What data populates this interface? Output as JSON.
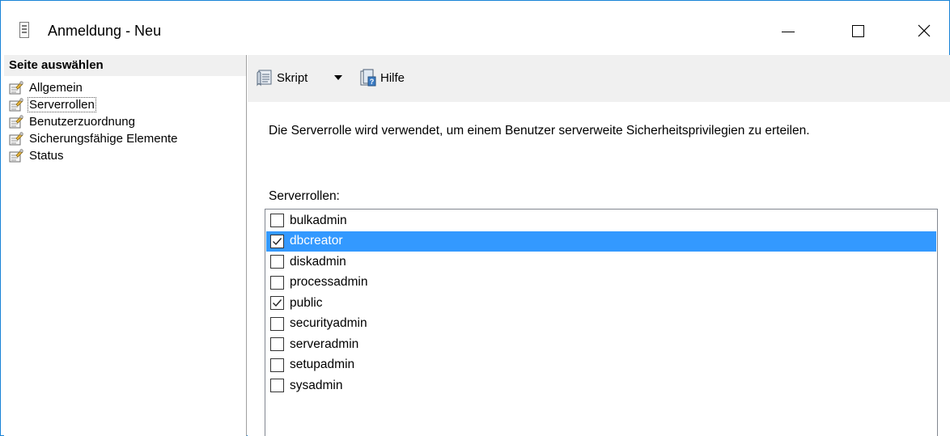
{
  "window": {
    "title": "Anmeldung - Neu"
  },
  "left_panel": {
    "header": "Seite auswählen",
    "items": [
      {
        "label": "Allgemein",
        "icon": "wrench-page-icon"
      },
      {
        "label": "Serverrollen",
        "icon": "wrench-page-icon",
        "selected": true
      },
      {
        "label": "Benutzerzuordnung",
        "icon": "wrench-page-icon"
      },
      {
        "label": "Sicherungsfähige Elemente",
        "icon": "wrench-page-icon"
      },
      {
        "label": "Status",
        "icon": "wrench-page-icon"
      }
    ]
  },
  "toolbar": {
    "script_label": "Skript",
    "help_label": "Hilfe"
  },
  "content": {
    "description": "Die Serverrolle wird verwendet, um einem Benutzer serverweite Sicherheitsprivilegien zu erteilen.",
    "roles_label": "Serverrollen:",
    "roles": [
      {
        "name": "bulkadmin",
        "checked": false,
        "selected": false
      },
      {
        "name": "dbcreator",
        "checked": true,
        "selected": true
      },
      {
        "name": "diskadmin",
        "checked": false,
        "selected": false
      },
      {
        "name": "processadmin",
        "checked": false,
        "selected": false
      },
      {
        "name": "public",
        "checked": true,
        "selected": false
      },
      {
        "name": "securityadmin",
        "checked": false,
        "selected": false
      },
      {
        "name": "serveradmin",
        "checked": false,
        "selected": false
      },
      {
        "name": "setupadmin",
        "checked": false,
        "selected": false
      },
      {
        "name": "sysadmin",
        "checked": false,
        "selected": false
      }
    ]
  },
  "colors": {
    "selection": "#3399ff",
    "window_border": "#1883d7",
    "panel_header_bg": "#f0f0f0"
  }
}
